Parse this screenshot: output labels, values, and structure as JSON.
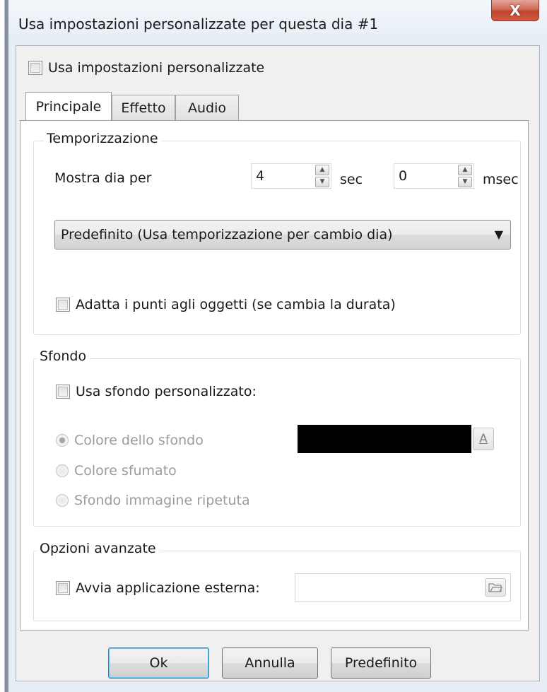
{
  "window": {
    "title": "Usa impostazioni personalizzate per questa dia #1",
    "close_glyph": "X"
  },
  "use_custom": {
    "label": "Usa impostazioni personalizzate",
    "checked": false
  },
  "tabs": [
    {
      "label": "Principale",
      "active": true
    },
    {
      "label": "Effetto",
      "active": false
    },
    {
      "label": "Audio",
      "active": false
    }
  ],
  "timing": {
    "legend": "Temporizzazione",
    "show_label": "Mostra dia per",
    "seconds_value": "4",
    "seconds_unit": "sec",
    "msec_value": "0",
    "msec_unit": "msec",
    "mode_selected": "Predefinito (Usa temporizzazione per cambio dia)",
    "adapt_label": "Adatta i punti agli oggetti (se cambia la durata)",
    "adapt_checked": false
  },
  "background": {
    "legend": "Sfondo",
    "custom_label": "Usa sfondo personalizzato:",
    "custom_checked": false,
    "options": [
      {
        "label": "Colore dello sfondo",
        "checked": true
      },
      {
        "label": "Colore sfumato",
        "checked": false
      },
      {
        "label": "Sfondo immagine ripetuta",
        "checked": false
      }
    ],
    "color": "#000000",
    "color_button_glyph": "A"
  },
  "advanced": {
    "legend": "Opzioni avanzate",
    "external_label": "Avvia applicazione esterna:",
    "external_checked": false,
    "path_value": ""
  },
  "buttons": {
    "ok": "Ok",
    "cancel": "Annulla",
    "default": "Predefinito"
  },
  "icons": {
    "spin_up": "spin-up-icon",
    "spin_down": "spin-down-icon",
    "dropdown": "chevron-down-icon",
    "browse": "folder-open-icon"
  }
}
